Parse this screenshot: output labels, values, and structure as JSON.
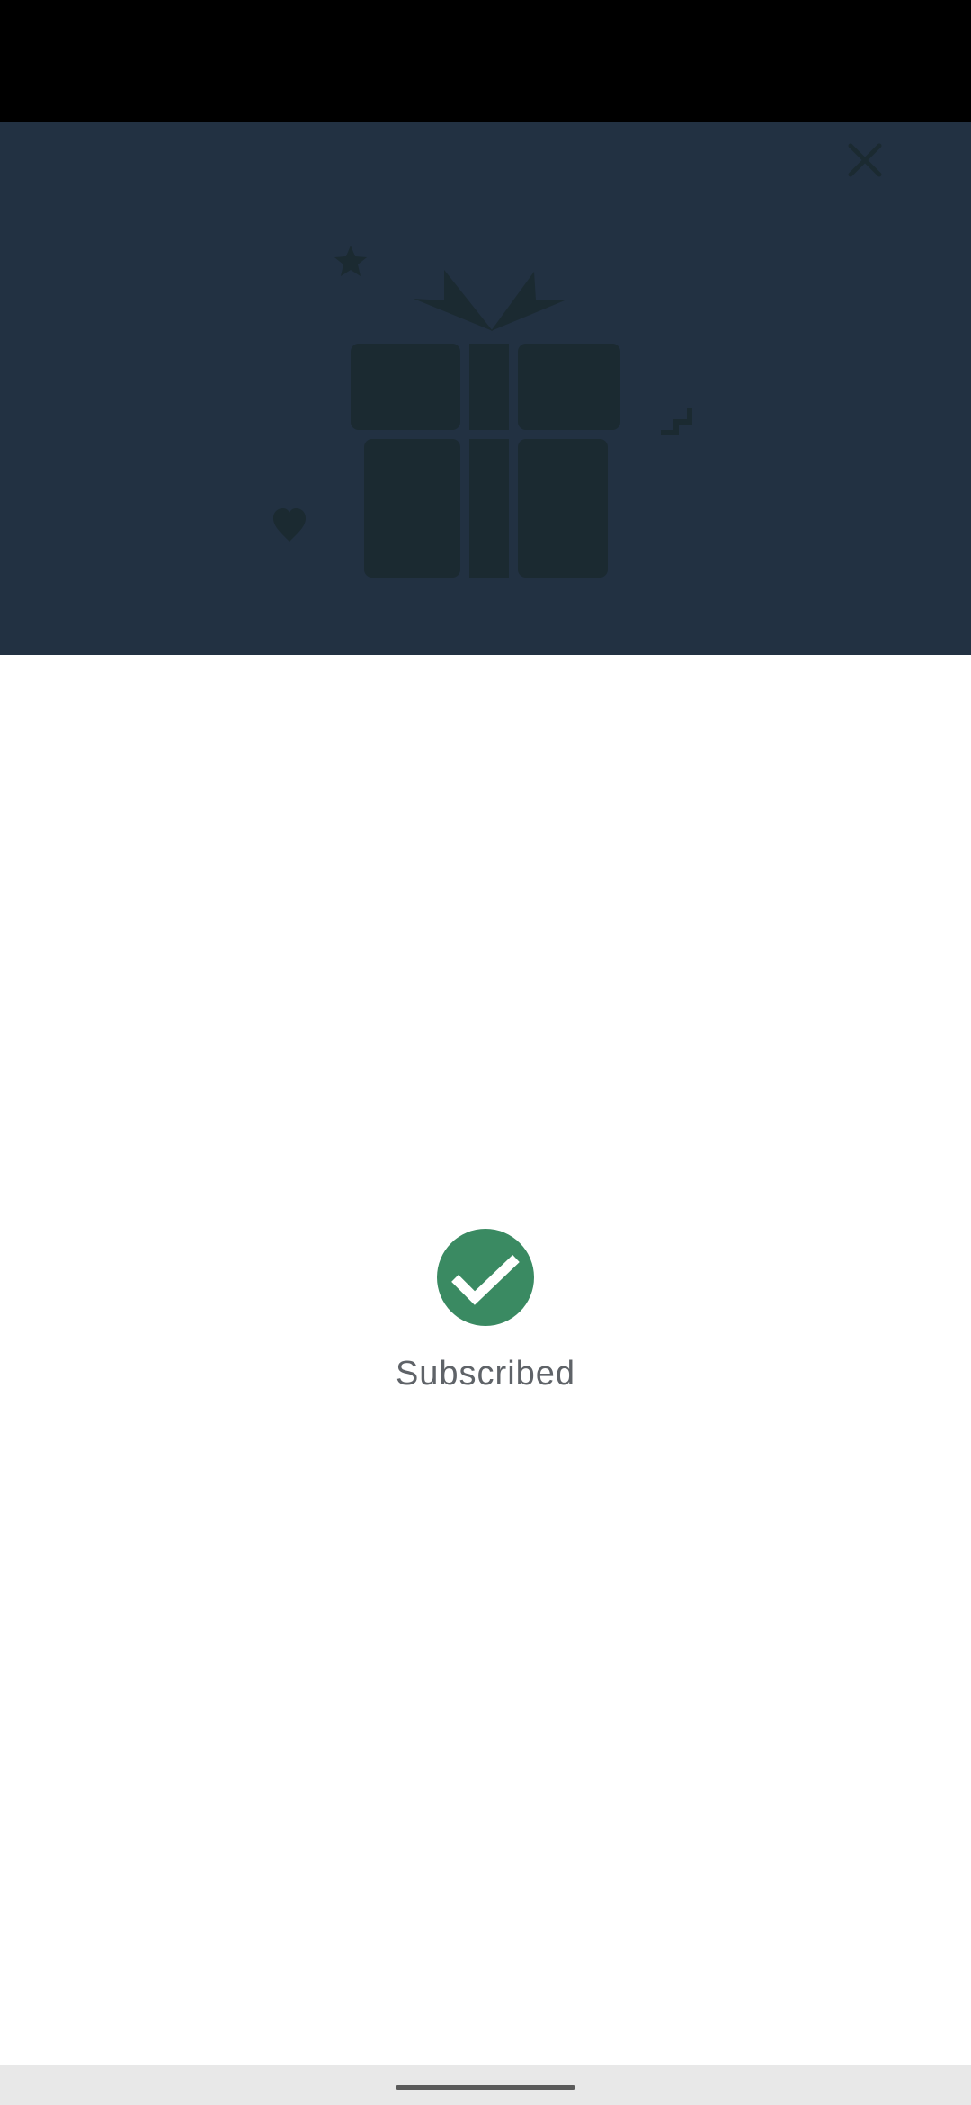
{
  "colors": {
    "status_bar": "#000000",
    "hero_background": "#223142",
    "hero_art": "#1b2a31",
    "success_green": "#3a8a62",
    "label_text": "#5f6368",
    "nav_bar": "#e8e8e8"
  },
  "header": {
    "close_icon": "close-icon"
  },
  "hero": {
    "illustration": "gift-box-illustration",
    "decorations": [
      "star-icon",
      "heart-icon",
      "zigzag-icon"
    ]
  },
  "main": {
    "status_icon": "checkmark-circle-icon",
    "status_label": "Subscribed"
  }
}
